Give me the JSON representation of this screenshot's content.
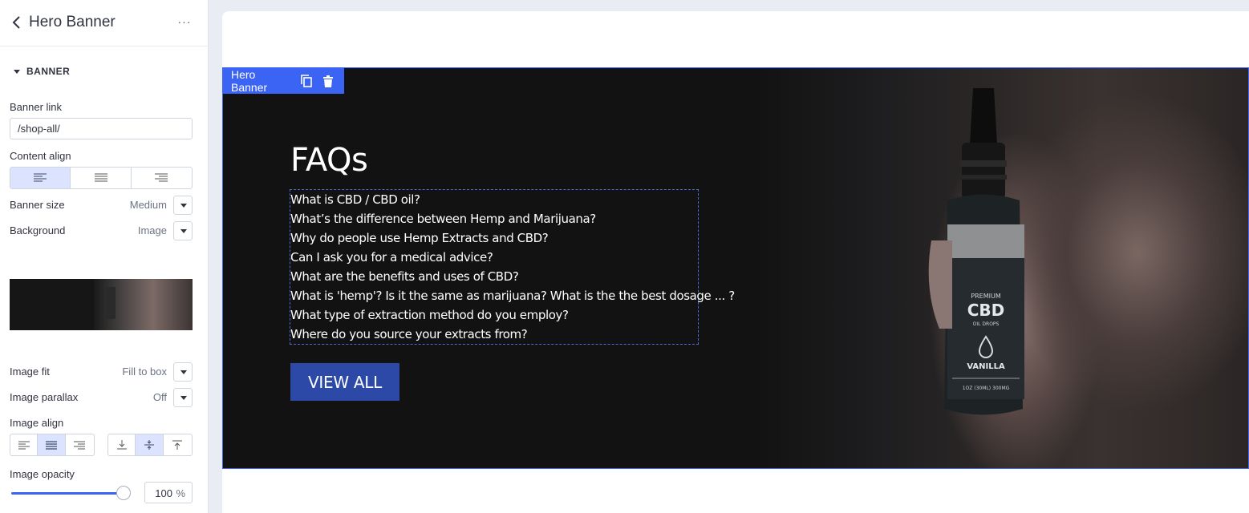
{
  "sidebar": {
    "title": "Hero Banner",
    "more_label": "···",
    "section_label": "BANNER",
    "banner_link": {
      "label": "Banner link",
      "value": "/shop-all/"
    },
    "content_align": {
      "label": "Content align",
      "options": [
        "left",
        "center",
        "right"
      ],
      "selected": "left"
    },
    "banner_size": {
      "label": "Banner size",
      "value": "Medium"
    },
    "background": {
      "label": "Background",
      "value": "Image"
    },
    "image_fit": {
      "label": "Image fit",
      "value": "Fill to box"
    },
    "image_parallax": {
      "label": "Image parallax",
      "value": "Off"
    },
    "image_align": {
      "label": "Image align",
      "horizontal_selected": "center",
      "vertical_selected": "middle"
    },
    "image_opacity": {
      "label": "Image opacity",
      "value": "100",
      "unit": "%"
    }
  },
  "canvas": {
    "hero_label": "Hero Banner",
    "title": "FAQs",
    "faq_items": [
      "What is CBD / CBD oil?",
      "What’s the difference between Hemp and Marijuana?",
      "Why do people use Hemp Extracts and CBD?",
      "Can I ask you for a medical advice?",
      "What are the benefits and uses of CBD?",
      "What is 'hemp'? Is it the same as marijuana? What is the the best dosage ... ?",
      "What type of extraction method do you employ?",
      "Where do you source your extracts from?"
    ],
    "button_label": "VIEW ALL"
  },
  "colors": {
    "accent": "#3c64f4",
    "button": "#2c49a8",
    "hero_bg": "#121212"
  }
}
